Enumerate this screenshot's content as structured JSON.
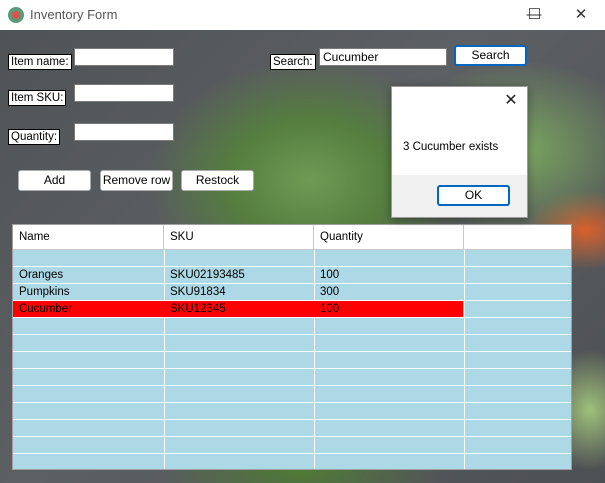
{
  "window": {
    "title": "Inventory Form",
    "controls": {
      "minimize": "—",
      "maximize": "☐",
      "close": "✕"
    }
  },
  "form": {
    "item_name_label": "Item name:",
    "item_name_value": "",
    "item_sku_label": "Item SKU:",
    "item_sku_value": "",
    "quantity_label": "Quantity:",
    "quantity_value": "",
    "search_label": "Search:",
    "search_value": "Cucumber",
    "search_button": "Search",
    "add_button": "Add",
    "remove_button": "Remove row",
    "restock_button": "Restock"
  },
  "grid": {
    "columns": [
      "Name",
      "SKU",
      "Quantity"
    ],
    "rows": [
      {
        "name": "",
        "sku": "",
        "quantity": "",
        "selected": false
      },
      {
        "name": "Oranges",
        "sku": "SKU02193485",
        "quantity": "100",
        "selected": false
      },
      {
        "name": "Pumpkins",
        "sku": "SKU91834",
        "quantity": "300",
        "selected": false
      },
      {
        "name": "Cucumber",
        "sku": "SKU12345",
        "quantity": "100",
        "selected": true
      }
    ]
  },
  "dialog": {
    "message": "3 Cucumber exists",
    "ok_button": "OK",
    "close": "✕"
  },
  "colors": {
    "grid_background": "#add8e6",
    "selected_row": "#ff0000",
    "accent": "#0067c0"
  }
}
